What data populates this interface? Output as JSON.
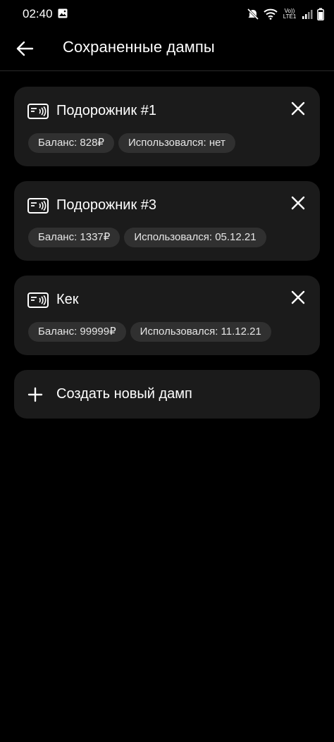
{
  "status_bar": {
    "time": "02:40",
    "network_label_top": "Vo))",
    "network_label_bottom": "LTE1"
  },
  "app_bar": {
    "title": "Сохраненные дампы"
  },
  "dumps": [
    {
      "title": "Подорожник #1",
      "balance": "Баланс: 828₽",
      "used": "Использовался: нет"
    },
    {
      "title": "Подорожник #3",
      "balance": "Баланс: 1337₽",
      "used": "Использовался: 05.12.21"
    },
    {
      "title": "Кек",
      "balance": "Баланс: 99999₽",
      "used": "Использовался: 11.12.21"
    }
  ],
  "create": {
    "label": "Создать новый дамп"
  },
  "icons": {
    "back": "arrow-back-icon",
    "card": "nfc-card-icon",
    "close": "close-icon",
    "add": "plus-icon"
  },
  "colors": {
    "background": "#000000",
    "card": "#1b1b1b",
    "chip": "#303030",
    "text": "#ffffff"
  }
}
